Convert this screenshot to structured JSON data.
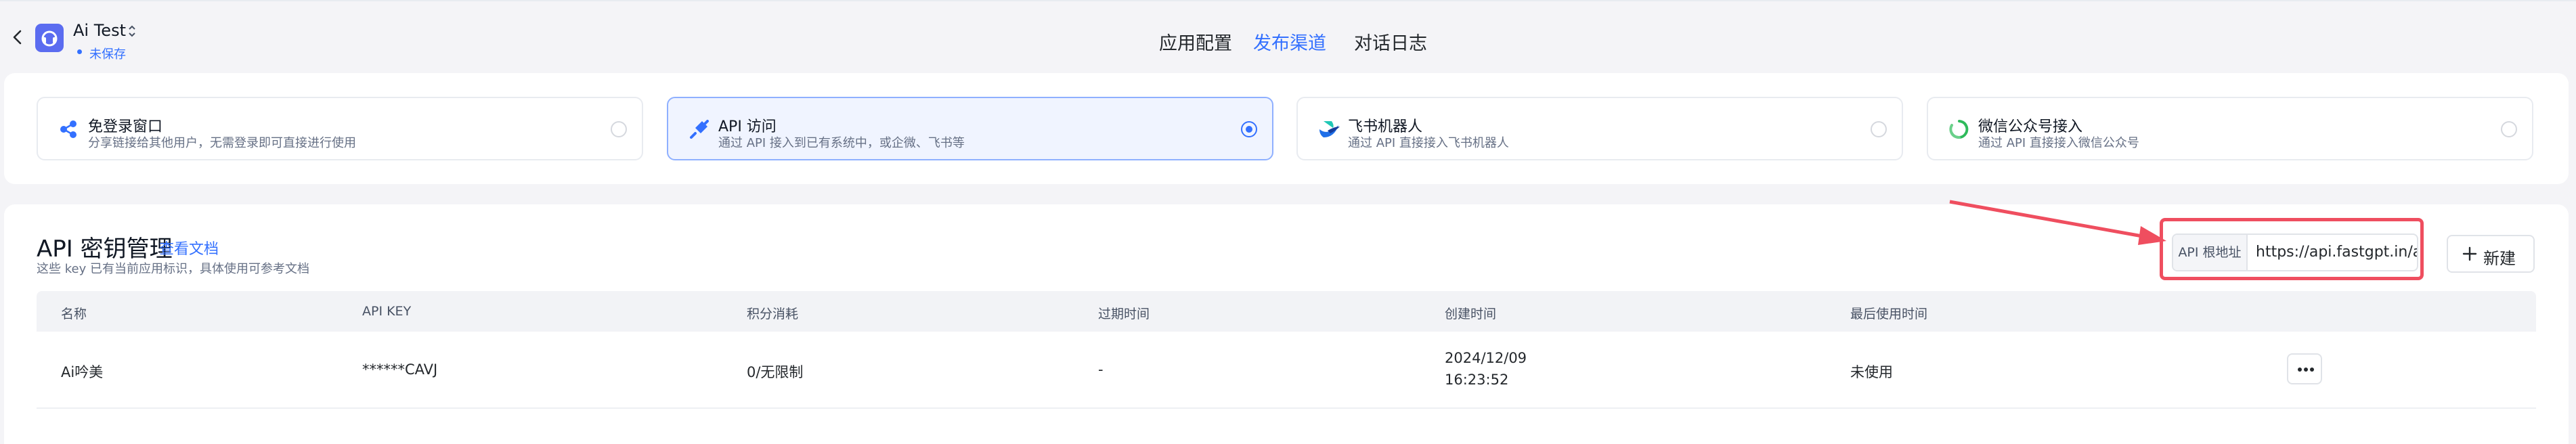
{
  "header": {
    "app_name": "Ai Test",
    "app_status": "未保存",
    "tabs": [
      {
        "label": "应用配置",
        "active": false
      },
      {
        "label": "发布渠道",
        "active": true
      },
      {
        "label": "对话日志",
        "active": false
      }
    ]
  },
  "channels": [
    {
      "title": "免登录窗口",
      "desc": "分享链接给其他用户，无需登录即可直接进行使用",
      "icon": "share-icon",
      "selected": false
    },
    {
      "title": "API 访问",
      "desc": "通过 API 接入到已有系统中，或企微、飞书等",
      "icon": "api-icon",
      "selected": true
    },
    {
      "title": "飞书机器人",
      "desc": "通过 API 直接接入飞书机器人",
      "icon": "feishu-icon",
      "selected": false
    },
    {
      "title": "微信公众号接入",
      "desc": "通过 API 直接接入微信公众号",
      "icon": "wechat-official-icon",
      "selected": false
    }
  ],
  "api_keys": {
    "title": "API 密钥管理",
    "doc_link": "查看文档",
    "subtitle": "这些 key 已有当前应用标识，具体使用可参考文档",
    "base_url_label": "API 根地址",
    "base_url": "https://api.fastgpt.in/api",
    "new_button": "新建",
    "columns": [
      "名称",
      "API KEY",
      "积分消耗",
      "过期时间",
      "创建时间",
      "最后使用时间"
    ],
    "rows": [
      {
        "name": "Ai吟美",
        "key": "******CAVJ",
        "usage": "0/无限制",
        "expire": "-",
        "created_date": "2024/12/09",
        "created_time": "16:23:52",
        "last_used": "未使用"
      }
    ]
  },
  "colors": {
    "accent": "#3370ff",
    "annotation": "#ef4e5f"
  }
}
